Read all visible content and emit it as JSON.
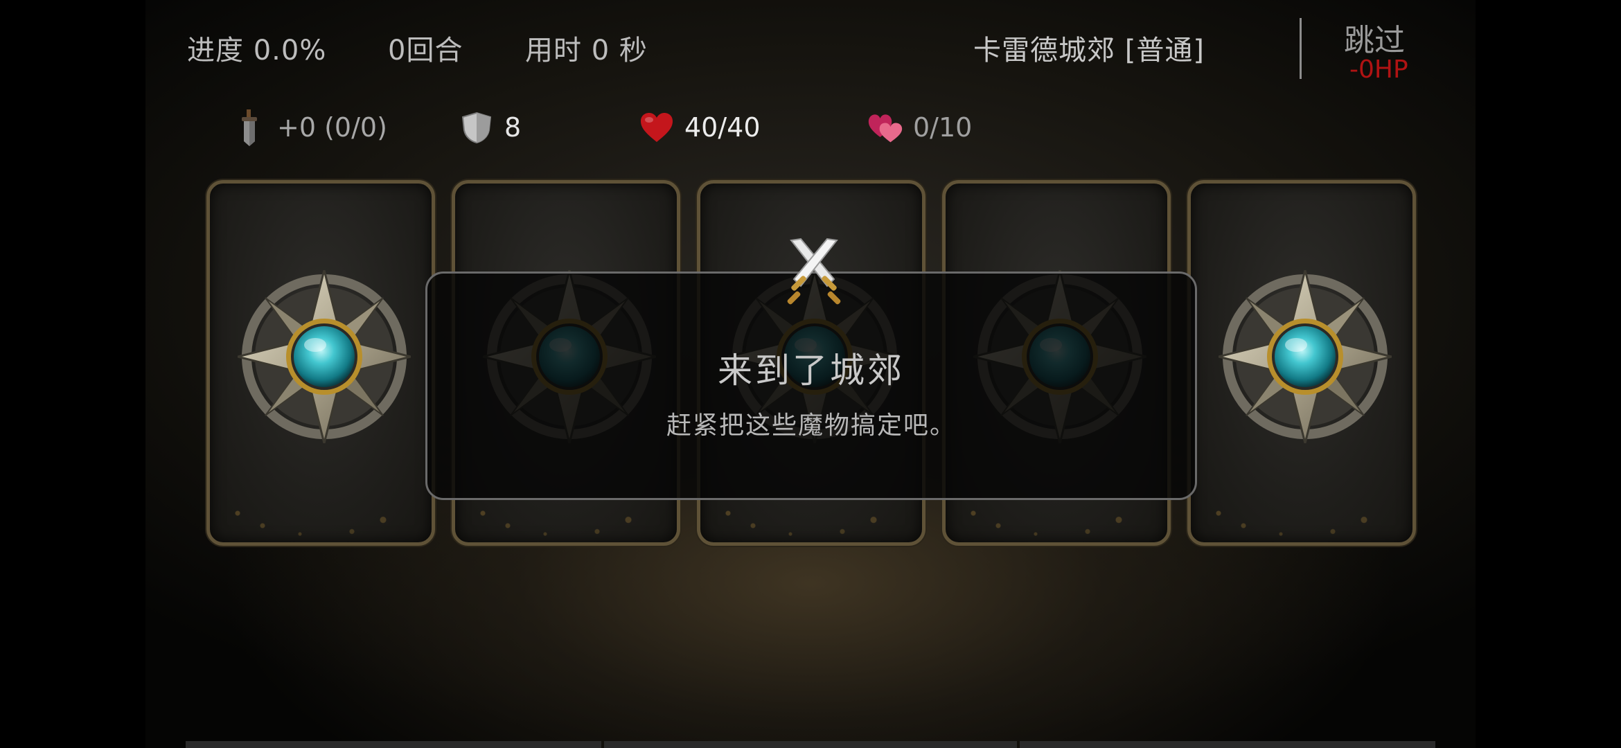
{
  "header": {
    "progress": "进度 0.0%",
    "turns": "0回合",
    "time": "用时 0 秒",
    "stage": "卡雷德城郊 [普通]",
    "skip_label": "跳过",
    "skip_cost": "-0HP"
  },
  "stats": {
    "weapon": {
      "icon": "dagger-icon",
      "text": "+0 (0/0)"
    },
    "armor": {
      "icon": "shield-icon",
      "text": "8"
    },
    "hp": {
      "icon": "heart-icon",
      "text": "40/40"
    },
    "love": {
      "icon": "double-heart-icon",
      "text": "0/10"
    }
  },
  "cards": [
    {
      "state": "face-down",
      "icon": "compass-gem-icon"
    },
    {
      "state": "face-down",
      "icon": "compass-gem-icon"
    },
    {
      "state": "face-down",
      "icon": "compass-gem-icon"
    },
    {
      "state": "face-down",
      "icon": "compass-gem-icon"
    },
    {
      "state": "face-down",
      "icon": "compass-gem-icon"
    }
  ],
  "dialog": {
    "icon": "crossed-swords-icon",
    "title": "来到了城郊",
    "message": "赶紧把这些魔物搞定吧。"
  },
  "colors": {
    "hp_cost": "#b01313",
    "heart": "#c4161c",
    "card_border": "#5f5237",
    "gem": "#3ec6cf"
  }
}
